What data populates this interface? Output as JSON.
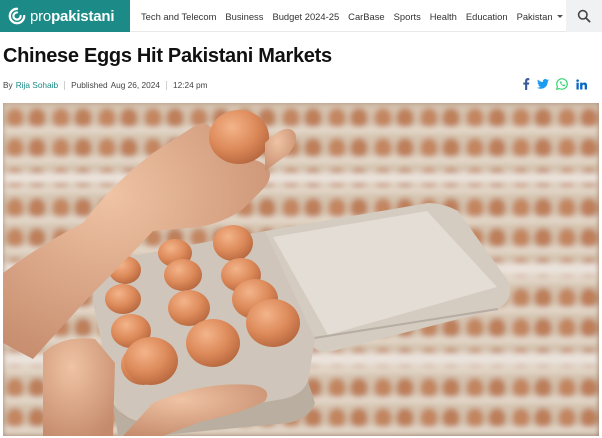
{
  "header": {
    "logo": {
      "prefix": "pro",
      "name": "pakistani",
      "brand_color": "#1c8a86"
    },
    "menu": [
      {
        "label": "Tech and Telecom"
      },
      {
        "label": "Business"
      },
      {
        "label": "Budget 2024-25"
      },
      {
        "label": "CarBase"
      },
      {
        "label": "Sports"
      },
      {
        "label": "Health"
      },
      {
        "label": "Education"
      },
      {
        "label": "Pakistan",
        "dropdown": true
      }
    ],
    "search_icon": "search-icon"
  },
  "article": {
    "title": "Chinese Eggs Hit Pakistani Markets",
    "byline": {
      "by": "By",
      "author": "Rija Sohaib",
      "published_label": "Published",
      "date": "Aug 26, 2024",
      "time": "12:24 pm"
    },
    "share": [
      {
        "icon": "facebook-icon",
        "color": "#3b5998"
      },
      {
        "icon": "twitter-icon",
        "color": "#1d9bf0"
      },
      {
        "icon": "whatsapp-icon",
        "color": "#25d366"
      },
      {
        "icon": "linkedin-icon",
        "color": "#0a66c2"
      }
    ]
  }
}
